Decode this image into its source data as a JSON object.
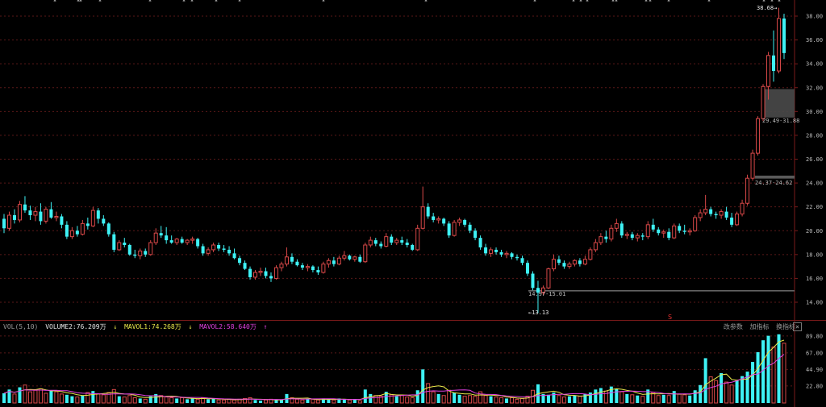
{
  "chart_data": {
    "type": "candlestick",
    "price_axis": {
      "ticks": [
        "38.00",
        "36.00",
        "34.00",
        "32.00",
        "30.00",
        "28.00",
        "26.00",
        "24.00",
        "22.00",
        "20.00",
        "18.00",
        "16.00",
        "14.00"
      ],
      "ylim": [
        13.0,
        39.2
      ]
    },
    "volume_axis": {
      "ticks": [
        "89.80",
        "67.00",
        "44.90",
        "22.80"
      ],
      "ylim": [
        0,
        95
      ]
    },
    "annotations": {
      "high_label": "38.68→",
      "low_label": "←13.13",
      "zone_upper": "29.49-31.88",
      "zone_middle": "24.37-24.62",
      "zone_lower": "14.97-15.01",
      "marker_s": "S"
    },
    "volume_header": {
      "title": "VOL(5,10)",
      "volume": "VOLUME2:76.209万",
      "mavol1": "MAVOL1:74.268万",
      "mavol2": "MAVOL2:58.640万",
      "arrow_down": "↓",
      "arrow_up": "↑"
    },
    "volume_tools": [
      "改参数",
      "加指标",
      "换指标"
    ],
    "colors": {
      "up": "#d84848",
      "down": "#3ef2f5",
      "mavol1": "#e8e84a",
      "mavol2": "#e040e0",
      "grid": "#5a1818",
      "axis_text": "#bbbbbb"
    },
    "candles": [
      [
        21.0,
        21.4,
        19.8,
        20.2
      ],
      [
        20.2,
        21.6,
        20.0,
        21.3
      ],
      [
        21.3,
        21.8,
        20.6,
        20.9
      ],
      [
        20.9,
        22.5,
        20.7,
        22.2
      ],
      [
        22.2,
        22.9,
        21.5,
        21.7
      ],
      [
        21.7,
        22.1,
        20.9,
        21.3
      ],
      [
        21.3,
        22.0,
        20.8,
        21.6
      ],
      [
        21.6,
        22.3,
        20.5,
        20.8
      ],
      [
        20.8,
        22.0,
        20.6,
        21.8
      ],
      [
        21.8,
        22.4,
        21.0,
        21.1
      ],
      [
        21.1,
        21.6,
        20.8,
        21.2
      ],
      [
        21.2,
        21.4,
        20.2,
        20.5
      ],
      [
        20.5,
        20.8,
        19.3,
        19.5
      ],
      [
        19.5,
        20.3,
        19.3,
        20.0
      ],
      [
        20.0,
        20.4,
        19.5,
        19.7
      ],
      [
        19.7,
        20.9,
        19.6,
        20.6
      ],
      [
        20.6,
        21.1,
        20.1,
        20.4
      ],
      [
        20.4,
        22.0,
        20.3,
        21.7
      ],
      [
        21.7,
        21.9,
        20.6,
        21.0
      ],
      [
        21.0,
        21.3,
        20.4,
        20.6
      ],
      [
        20.6,
        20.7,
        19.5,
        19.7
      ],
      [
        19.7,
        19.9,
        18.2,
        18.4
      ],
      [
        18.4,
        19.2,
        18.3,
        19.0
      ],
      [
        19.0,
        19.4,
        18.6,
        18.8
      ],
      [
        18.8,
        18.9,
        17.9,
        18.0
      ],
      [
        18.0,
        18.4,
        17.7,
        17.9
      ],
      [
        17.9,
        18.5,
        17.6,
        18.3
      ],
      [
        18.3,
        18.5,
        17.8,
        18.0
      ],
      [
        18.0,
        19.2,
        17.9,
        19.0
      ],
      [
        19.0,
        20.2,
        18.8,
        19.8
      ],
      [
        19.8,
        20.4,
        19.4,
        19.6
      ],
      [
        19.6,
        20.3,
        18.9,
        19.2
      ],
      [
        19.2,
        19.6,
        18.9,
        19.0
      ],
      [
        19.0,
        19.4,
        18.8,
        19.3
      ],
      [
        19.3,
        19.5,
        18.9,
        19.0
      ],
      [
        19.0,
        19.3,
        18.8,
        19.2
      ],
      [
        19.2,
        19.5,
        18.9,
        19.3
      ],
      [
        19.3,
        19.4,
        18.5,
        18.7
      ],
      [
        18.7,
        18.9,
        17.9,
        18.1
      ],
      [
        18.1,
        18.6,
        17.9,
        18.4
      ],
      [
        18.4,
        19.0,
        18.2,
        18.8
      ],
      [
        18.8,
        19.0,
        18.3,
        18.5
      ],
      [
        18.5,
        18.8,
        18.2,
        18.4
      ],
      [
        18.4,
        18.7,
        17.9,
        18.1
      ],
      [
        18.1,
        18.5,
        17.6,
        17.7
      ],
      [
        17.7,
        17.9,
        17.1,
        17.3
      ],
      [
        17.3,
        17.5,
        16.7,
        16.8
      ],
      [
        16.8,
        17.0,
        15.9,
        16.1
      ],
      [
        16.1,
        16.7,
        15.9,
        16.5
      ],
      [
        16.5,
        16.9,
        16.2,
        16.6
      ],
      [
        16.6,
        16.9,
        16.0,
        16.2
      ],
      [
        16.2,
        16.5,
        15.7,
        16.0
      ],
      [
        16.0,
        17.1,
        15.9,
        16.9
      ],
      [
        16.9,
        17.4,
        16.6,
        17.2
      ],
      [
        17.2,
        18.6,
        17.0,
        17.8
      ],
      [
        17.8,
        18.1,
        17.2,
        17.4
      ],
      [
        17.4,
        17.6,
        17.0,
        17.1
      ],
      [
        17.1,
        17.3,
        16.7,
        16.9
      ],
      [
        16.9,
        17.2,
        16.6,
        17.0
      ],
      [
        17.0,
        17.1,
        16.5,
        16.7
      ],
      [
        16.7,
        17.0,
        16.3,
        16.5
      ],
      [
        16.5,
        17.4,
        16.4,
        17.2
      ],
      [
        17.2,
        17.7,
        16.9,
        17.5
      ],
      [
        17.5,
        17.8,
        17.0,
        17.2
      ],
      [
        17.2,
        17.9,
        17.1,
        17.7
      ],
      [
        17.7,
        18.3,
        17.5,
        17.9
      ],
      [
        17.9,
        18.0,
        17.5,
        17.6
      ],
      [
        17.6,
        17.9,
        17.4,
        17.8
      ],
      [
        17.8,
        18.0,
        17.3,
        17.4
      ],
      [
        17.4,
        19.0,
        17.3,
        18.8
      ],
      [
        18.8,
        19.5,
        18.6,
        19.2
      ],
      [
        19.2,
        19.4,
        18.7,
        18.9
      ],
      [
        18.9,
        19.1,
        18.5,
        18.7
      ],
      [
        18.7,
        19.8,
        18.6,
        19.5
      ],
      [
        19.5,
        19.7,
        18.8,
        19.0
      ],
      [
        19.0,
        19.4,
        18.8,
        19.2
      ],
      [
        19.2,
        19.5,
        18.8,
        19.0
      ],
      [
        19.0,
        19.3,
        18.6,
        18.8
      ],
      [
        18.8,
        18.9,
        18.3,
        18.4
      ],
      [
        18.4,
        20.5,
        18.3,
        20.2
      ],
      [
        20.2,
        23.7,
        20.1,
        22.0
      ],
      [
        22.0,
        22.3,
        21.0,
        21.2
      ],
      [
        21.2,
        21.5,
        20.7,
        20.9
      ],
      [
        20.9,
        21.2,
        20.6,
        21.0
      ],
      [
        21.0,
        21.1,
        20.4,
        20.6
      ],
      [
        20.6,
        20.8,
        19.4,
        19.6
      ],
      [
        19.6,
        20.9,
        19.5,
        20.7
      ],
      [
        20.7,
        21.1,
        20.4,
        20.9
      ],
      [
        20.9,
        21.0,
        20.3,
        20.5
      ],
      [
        20.5,
        20.7,
        19.8,
        20.0
      ],
      [
        20.0,
        20.2,
        19.2,
        19.4
      ],
      [
        19.4,
        19.6,
        18.4,
        18.6
      ],
      [
        18.6,
        18.9,
        17.9,
        18.1
      ],
      [
        18.1,
        18.6,
        17.8,
        18.4
      ],
      [
        18.4,
        18.6,
        18.0,
        18.2
      ],
      [
        18.2,
        18.4,
        17.8,
        18.0
      ],
      [
        18.0,
        18.3,
        17.7,
        18.1
      ],
      [
        18.1,
        18.2,
        17.6,
        17.8
      ],
      [
        17.8,
        18.0,
        17.5,
        17.7
      ],
      [
        17.7,
        17.9,
        17.1,
        17.3
      ],
      [
        17.3,
        17.5,
        16.2,
        16.4
      ],
      [
        16.4,
        16.6,
        15.0,
        15.2
      ],
      [
        15.2,
        15.8,
        13.1,
        14.8
      ],
      [
        14.8,
        15.4,
        14.6,
        15.2
      ],
      [
        15.2,
        16.9,
        15.1,
        16.8
      ],
      [
        16.8,
        18.0,
        16.6,
        17.6
      ],
      [
        17.6,
        17.9,
        17.1,
        17.3
      ],
      [
        17.3,
        17.5,
        16.8,
        17.0
      ],
      [
        17.0,
        17.4,
        16.8,
        17.2
      ],
      [
        17.2,
        17.6,
        17.0,
        17.5
      ],
      [
        17.5,
        17.7,
        17.0,
        17.2
      ],
      [
        17.2,
        17.9,
        17.1,
        17.6
      ],
      [
        17.6,
        18.6,
        17.5,
        18.4
      ],
      [
        18.4,
        19.3,
        18.2,
        19.0
      ],
      [
        19.0,
        19.8,
        18.8,
        19.5
      ],
      [
        19.5,
        20.0,
        19.0,
        19.3
      ],
      [
        19.3,
        20.5,
        19.1,
        20.2
      ],
      [
        20.2,
        21.0,
        19.9,
        20.6
      ],
      [
        20.6,
        20.8,
        19.4,
        19.6
      ],
      [
        19.6,
        19.9,
        19.3,
        19.7
      ],
      [
        19.7,
        19.9,
        19.2,
        19.4
      ],
      [
        19.4,
        19.8,
        19.1,
        19.6
      ],
      [
        19.6,
        19.8,
        19.2,
        19.5
      ],
      [
        19.5,
        20.8,
        19.3,
        20.5
      ],
      [
        20.5,
        21.0,
        19.9,
        20.1
      ],
      [
        20.1,
        20.3,
        19.6,
        19.8
      ],
      [
        19.8,
        20.1,
        19.4,
        19.9
      ],
      [
        19.9,
        20.2,
        19.2,
        19.4
      ],
      [
        19.4,
        20.6,
        19.3,
        20.4
      ],
      [
        20.4,
        20.6,
        19.8,
        20.0
      ],
      [
        20.0,
        20.5,
        19.7,
        19.9
      ],
      [
        19.9,
        20.2,
        19.6,
        20.0
      ],
      [
        20.0,
        21.3,
        19.9,
        21.1
      ],
      [
        21.1,
        21.8,
        20.8,
        21.5
      ],
      [
        21.5,
        23.0,
        21.3,
        21.8
      ],
      [
        21.8,
        22.0,
        21.2,
        21.4
      ],
      [
        21.4,
        21.6,
        21.0,
        21.3
      ],
      [
        21.3,
        21.8,
        21.0,
        21.6
      ],
      [
        21.6,
        22.0,
        20.9,
        21.1
      ],
      [
        21.1,
        21.5,
        20.3,
        20.5
      ],
      [
        20.5,
        21.6,
        20.4,
        21.4
      ],
      [
        21.4,
        22.6,
        21.2,
        22.3
      ],
      [
        22.3,
        24.7,
        22.1,
        24.4
      ],
      [
        24.4,
        26.8,
        24.2,
        26.5
      ],
      [
        26.5,
        29.6,
        26.3,
        29.4
      ],
      [
        29.4,
        32.3,
        29.2,
        32.1
      ],
      [
        32.1,
        35.0,
        31.0,
        34.7
      ],
      [
        34.7,
        36.8,
        32.5,
        33.4
      ],
      [
        33.4,
        38.7,
        33.2,
        37.8
      ],
      [
        37.8,
        38.2,
        34.4,
        34.9
      ]
    ],
    "volumes": [
      [
        13,
        0
      ],
      [
        18,
        0
      ],
      [
        12,
        1
      ],
      [
        21,
        0
      ],
      [
        24,
        1
      ],
      [
        15,
        1
      ],
      [
        17,
        1
      ],
      [
        19,
        1
      ],
      [
        13,
        1
      ],
      [
        17,
        0
      ],
      [
        15,
        1
      ],
      [
        12,
        1
      ],
      [
        11,
        0
      ],
      [
        9,
        0
      ],
      [
        8,
        1
      ],
      [
        10,
        0
      ],
      [
        14,
        1
      ],
      [
        16,
        0
      ],
      [
        12,
        1
      ],
      [
        11,
        1
      ],
      [
        14,
        1
      ],
      [
        18,
        1
      ],
      [
        9,
        0
      ],
      [
        8,
        1
      ],
      [
        10,
        1
      ],
      [
        7,
        1
      ],
      [
        6,
        0
      ],
      [
        5,
        1
      ],
      [
        9,
        0
      ],
      [
        12,
        0
      ],
      [
        10,
        1
      ],
      [
        8,
        1
      ],
      [
        7,
        1
      ],
      [
        6,
        0
      ],
      [
        7,
        1
      ],
      [
        5,
        0
      ],
      [
        6,
        0
      ],
      [
        5,
        1
      ],
      [
        7,
        1
      ],
      [
        5,
        0
      ],
      [
        6,
        0
      ],
      [
        4,
        1
      ],
      [
        4,
        1
      ],
      [
        5,
        1
      ],
      [
        4,
        1
      ],
      [
        5,
        1
      ],
      [
        6,
        1
      ],
      [
        7,
        1
      ],
      [
        4,
        0
      ],
      [
        3,
        0
      ],
      [
        4,
        1
      ],
      [
        5,
        1
      ],
      [
        4,
        0
      ],
      [
        4,
        0
      ],
      [
        12,
        0
      ],
      [
        7,
        1
      ],
      [
        5,
        1
      ],
      [
        4,
        1
      ],
      [
        5,
        0
      ],
      [
        5,
        1
      ],
      [
        4,
        1
      ],
      [
        6,
        0
      ],
      [
        5,
        0
      ],
      [
        4,
        1
      ],
      [
        6,
        0
      ],
      [
        5,
        0
      ],
      [
        4,
        1
      ],
      [
        5,
        0
      ],
      [
        3,
        1
      ],
      [
        18,
        0
      ],
      [
        12,
        0
      ],
      [
        10,
        1
      ],
      [
        9,
        1
      ],
      [
        15,
        0
      ],
      [
        11,
        1
      ],
      [
        9,
        0
      ],
      [
        10,
        1
      ],
      [
        8,
        1
      ],
      [
        7,
        1
      ],
      [
        17,
        0
      ],
      [
        45,
        0
      ],
      [
        26,
        1
      ],
      [
        15,
        1
      ],
      [
        12,
        0
      ],
      [
        10,
        1
      ],
      [
        17,
        1
      ],
      [
        14,
        0
      ],
      [
        11,
        0
      ],
      [
        9,
        1
      ],
      [
        10,
        1
      ],
      [
        9,
        1
      ],
      [
        15,
        1
      ],
      [
        10,
        1
      ],
      [
        9,
        0
      ],
      [
        8,
        1
      ],
      [
        7,
        1
      ],
      [
        6,
        0
      ],
      [
        7,
        1
      ],
      [
        5,
        1
      ],
      [
        6,
        1
      ],
      [
        9,
        1
      ],
      [
        17,
        1
      ],
      [
        25,
        0
      ],
      [
        12,
        0
      ],
      [
        11,
        0
      ],
      [
        14,
        0
      ],
      [
        10,
        1
      ],
      [
        8,
        1
      ],
      [
        9,
        0
      ],
      [
        10,
        0
      ],
      [
        9,
        1
      ],
      [
        12,
        0
      ],
      [
        14,
        0
      ],
      [
        18,
        0
      ],
      [
        20,
        0
      ],
      [
        16,
        1
      ],
      [
        22,
        0
      ],
      [
        19,
        0
      ],
      [
        15,
        1
      ],
      [
        12,
        0
      ],
      [
        11,
        1
      ],
      [
        10,
        0
      ],
      [
        9,
        1
      ],
      [
        18,
        0
      ],
      [
        14,
        1
      ],
      [
        10,
        1
      ],
      [
        11,
        0
      ],
      [
        10,
        1
      ],
      [
        16,
        0
      ],
      [
        12,
        1
      ],
      [
        11,
        1
      ],
      [
        10,
        0
      ],
      [
        17,
        0
      ],
      [
        24,
        0
      ],
      [
        60,
        0
      ],
      [
        35,
        1
      ],
      [
        30,
        1
      ],
      [
        40,
        0
      ],
      [
        28,
        1
      ],
      [
        24,
        1
      ],
      [
        30,
        0
      ],
      [
        36,
        0
      ],
      [
        42,
        0
      ],
      [
        55,
        0
      ],
      [
        68,
        0
      ],
      [
        84,
        0
      ],
      [
        90,
        0
      ],
      [
        75,
        1
      ],
      [
        92,
        0
      ],
      [
        80,
        1
      ]
    ]
  }
}
